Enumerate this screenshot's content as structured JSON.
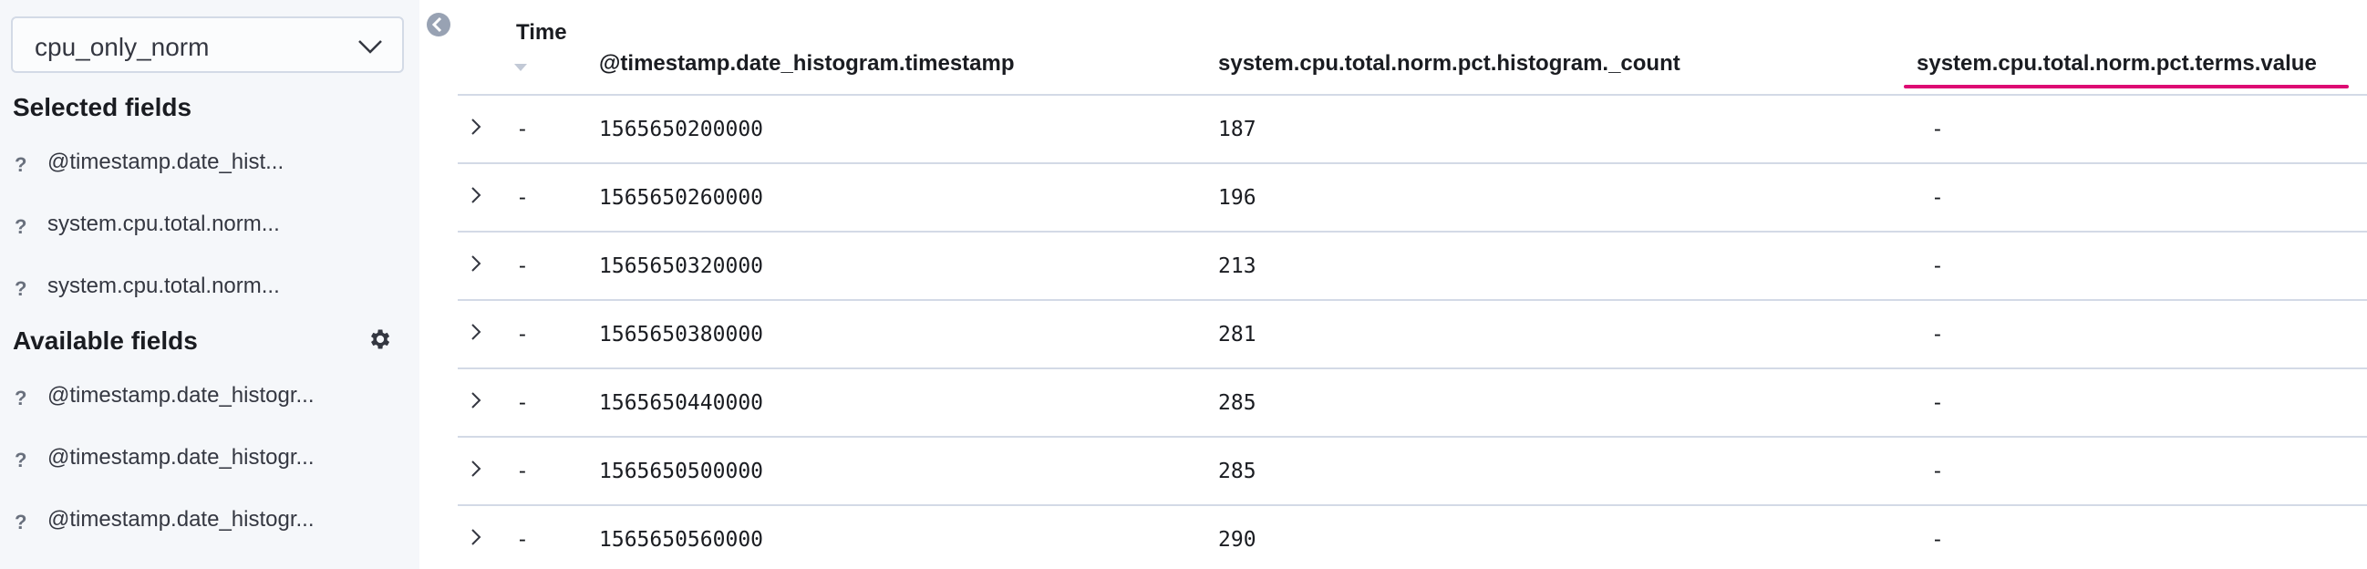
{
  "sidebar": {
    "index_pattern": "cpu_only_norm",
    "selected_title": "Selected fields",
    "selected_fields": [
      {
        "type": "?",
        "name": "@timestamp.date_hist..."
      },
      {
        "type": "?",
        "name": "system.cpu.total.norm..."
      },
      {
        "type": "?",
        "name": "system.cpu.total.norm..."
      }
    ],
    "available_title": "Available fields",
    "available_fields": [
      {
        "type": "?",
        "name": "@timestamp.date_histogr..."
      },
      {
        "type": "?",
        "name": "@timestamp.date_histogr..."
      },
      {
        "type": "?",
        "name": "@timestamp.date_histogr..."
      }
    ]
  },
  "table": {
    "headers": {
      "time": "Time",
      "timestamp": "@timestamp.date_histogram.timestamp",
      "count": "system.cpu.total.norm.pct.histogram._count",
      "terms": "system.cpu.total.norm.pct.terms.value"
    },
    "rows": [
      {
        "time": "-",
        "timestamp": "1565650200000",
        "count": "187",
        "terms": "-"
      },
      {
        "time": "-",
        "timestamp": "1565650260000",
        "count": "196",
        "terms": "-"
      },
      {
        "time": "-",
        "timestamp": "1565650320000",
        "count": "213",
        "terms": "-"
      },
      {
        "time": "-",
        "timestamp": "1565650380000",
        "count": "281",
        "terms": "-"
      },
      {
        "time": "-",
        "timestamp": "1565650440000",
        "count": "285",
        "terms": "-"
      },
      {
        "time": "-",
        "timestamp": "1565650500000",
        "count": "285",
        "terms": "-"
      },
      {
        "time": "-",
        "timestamp": "1565650560000",
        "count": "290",
        "terms": "-"
      }
    ]
  },
  "colors": {
    "accent_underline": "#dd0a73",
    "sidebar_bg": "#f5f7fa",
    "border": "#d3dae6"
  },
  "icons": [
    "chevron-down-icon",
    "gear-icon",
    "collapse-sidebar-icon",
    "sort-caret-icon",
    "expand-row-icon"
  ]
}
